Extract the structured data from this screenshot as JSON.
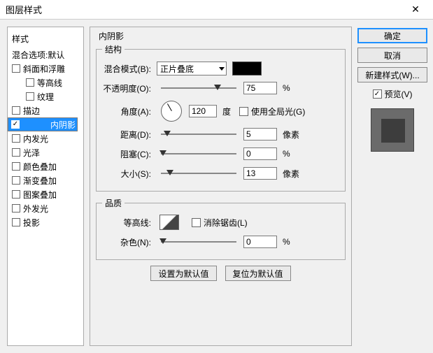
{
  "window": {
    "title": "图层样式"
  },
  "left": {
    "heading": "样式",
    "default": "混合选项:默认",
    "items": [
      {
        "label": "斜面和浮雕",
        "checked": false,
        "selected": false
      },
      {
        "label": "等高线",
        "checked": false,
        "selected": false,
        "indent": true
      },
      {
        "label": "纹理",
        "checked": false,
        "selected": false,
        "indent": true
      },
      {
        "label": "描边",
        "checked": false,
        "selected": false
      },
      {
        "label": "内阴影",
        "checked": true,
        "selected": true
      },
      {
        "label": "内发光",
        "checked": false,
        "selected": false
      },
      {
        "label": "光泽",
        "checked": false,
        "selected": false
      },
      {
        "label": "颜色叠加",
        "checked": false,
        "selected": false
      },
      {
        "label": "渐变叠加",
        "checked": false,
        "selected": false
      },
      {
        "label": "图案叠加",
        "checked": false,
        "selected": false
      },
      {
        "label": "外发光",
        "checked": false,
        "selected": false
      },
      {
        "label": "投影",
        "checked": false,
        "selected": false
      }
    ]
  },
  "panel": {
    "title": "内阴影",
    "structure_legend": "结构",
    "blend_mode_label": "混合模式(B):",
    "blend_mode_value": "正片叠底",
    "opacity_label": "不透明度(O):",
    "opacity_value": "75",
    "percent": "%",
    "angle_label": "角度(A):",
    "angle_value": "120",
    "degree": "度",
    "global_light_label": "使用全局光(G)",
    "distance_label": "距离(D):",
    "distance_value": "5",
    "pixels": "像素",
    "choke_label": "阻塞(C):",
    "choke_value": "0",
    "size_label": "大小(S):",
    "size_value": "13",
    "quality_legend": "品质",
    "contour_label": "等高线:",
    "antialias_label": "消除锯齿(L)",
    "noise_label": "杂色(N):",
    "noise_value": "0",
    "make_default": "设置为默认值",
    "reset_default": "复位为默认值"
  },
  "right": {
    "ok": "确定",
    "cancel": "取消",
    "new_style": "新建样式(W)...",
    "preview": "预览(V)"
  }
}
